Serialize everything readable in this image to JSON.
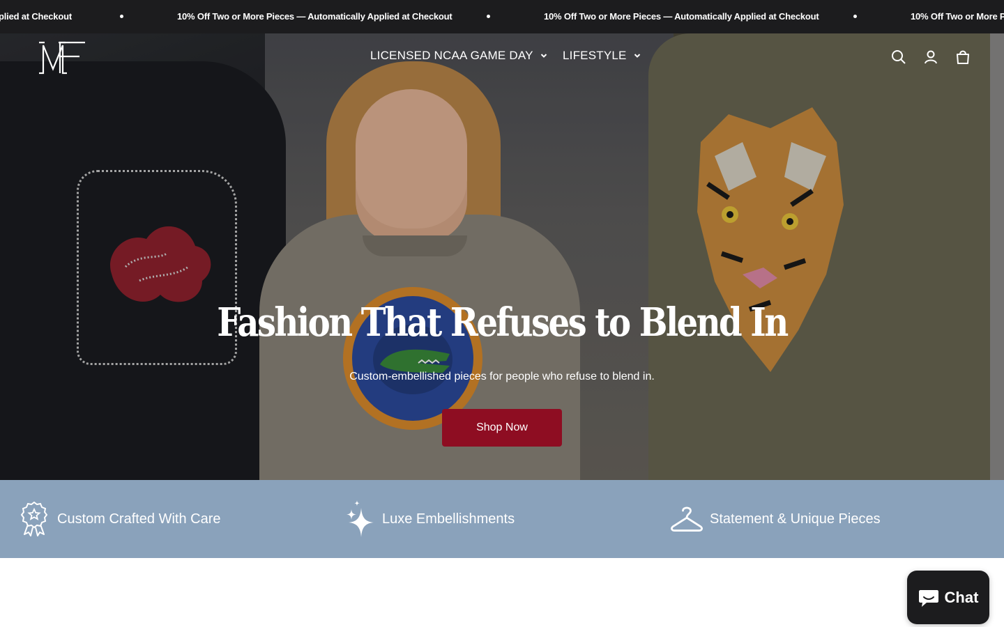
{
  "announcement": {
    "messages": [
      "plied at Checkout",
      "10% Off Two or More Pieces — Automatically Applied at Checkout",
      "10% Off Two or More Pieces — Automatically Applied at Checkout",
      "10% Off Two or More Pie"
    ]
  },
  "header": {
    "logo_text": "MF",
    "nav": [
      {
        "label": "LICENSED NCAA GAME DAY"
      },
      {
        "label": "LIFESTYLE"
      }
    ],
    "icons": [
      "search-icon",
      "account-icon",
      "cart-icon"
    ]
  },
  "hero": {
    "title": "Fashion That Refuses to Blend In",
    "subtitle": "Custom-embellished pieces for people who refuse to blend in.",
    "cta_label": "Shop Now",
    "cta_color": "#8e0d22"
  },
  "features": {
    "background_color": "#8aa2bb",
    "items": [
      {
        "label": "Custom Crafted With Care",
        "icon": "award-ribbon-icon"
      },
      {
        "label": "Luxe Embellishments",
        "icon": "sparkle-icon"
      },
      {
        "label": "Statement & Unique Pieces",
        "icon": "hanger-icon"
      }
    ]
  },
  "chat": {
    "label": "Chat",
    "icon": "chat-bubble-icon"
  }
}
